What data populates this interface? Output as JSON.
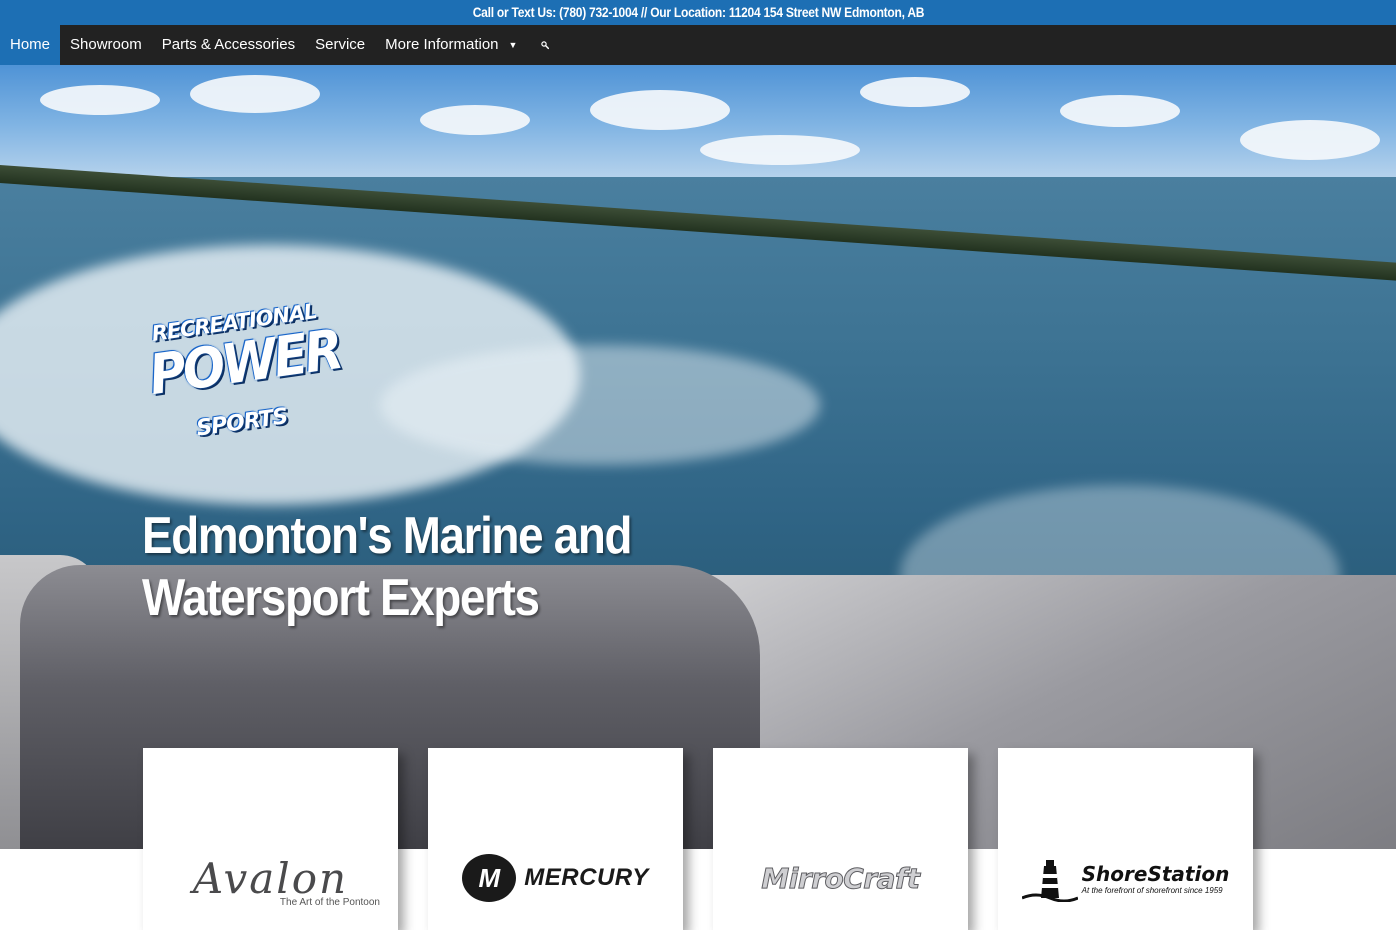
{
  "topbar": {
    "text": "Call or Text Us: (780) 732-1004 // Our Location: 11204 154 Street NW Edmonton, AB"
  },
  "nav": {
    "items": [
      {
        "label": "Home",
        "active": true
      },
      {
        "label": "Showroom",
        "active": false
      },
      {
        "label": "Parts & Accessories",
        "active": false
      },
      {
        "label": "Service",
        "active": false
      },
      {
        "label": "More Information",
        "active": false,
        "has_dropdown": true
      }
    ],
    "search_icon": "search-icon",
    "dropdown_icon": "caret-down-icon"
  },
  "hero": {
    "logo": {
      "line1": "RECREATIONAL",
      "line2": "POWER",
      "line3": "SPORTS"
    },
    "headline_line1": "Edmonton's Marine and",
    "headline_line2": "Watersport Experts"
  },
  "brands": [
    {
      "name": "Avalon",
      "tagline": "The Art of the Pontoon"
    },
    {
      "name": "MERCURY",
      "badge": "M"
    },
    {
      "name": "MirroCraft"
    },
    {
      "name": "ShoreStation",
      "tagline": "At the forefront of shorefront since 1959"
    }
  ],
  "colors": {
    "topbar_bg": "#1d6fb4",
    "nav_bg": "#222222",
    "nav_active_bg": "#1d6fb4"
  }
}
